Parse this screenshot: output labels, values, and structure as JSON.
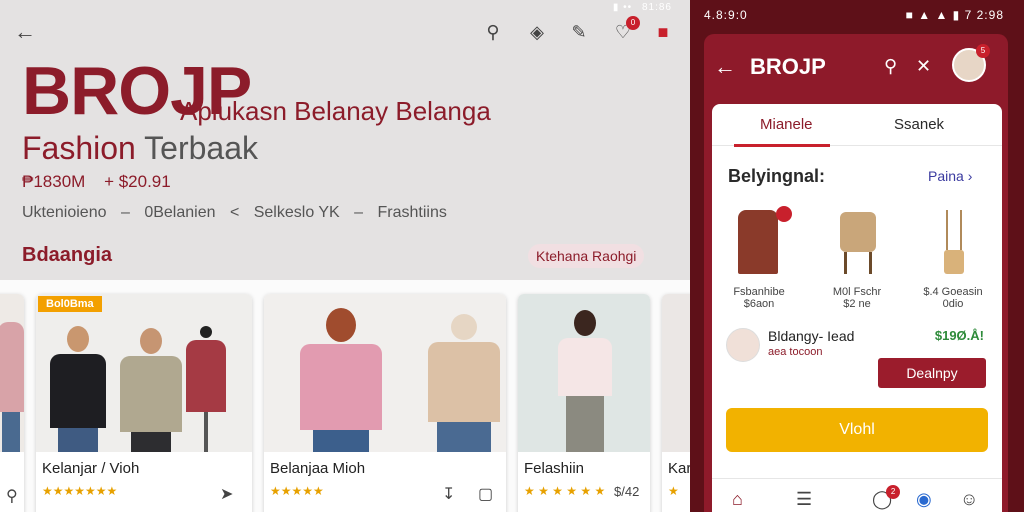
{
  "left": {
    "status_left": "▮ ••",
    "status_right": "81:86",
    "badge_count": "0",
    "brand": "BROJP",
    "tagline": "Aplukasn Belanay Belanga",
    "tag_a": "Fashion",
    "tag_b": "Terbaak",
    "price_1": "₱1830M",
    "price_2": "+ $20.91",
    "crumbs": [
      "Uktenioieno",
      "–",
      "0Belanien",
      "<",
      "Selkeslo YK",
      "–",
      "Frashtiins"
    ],
    "section_title": "Bdaangia",
    "section_pill": "Ktehana Raohgi",
    "cards": [
      {
        "title": "",
        "stars": ""
      },
      {
        "badge": "Bol0Bma",
        "title": "Kelanjar / Vioh",
        "stars": "★★★★★★★"
      },
      {
        "title": "Belanjaa Mioh",
        "stars": "★★★★★"
      },
      {
        "title": "Felashiin",
        "stars": "★ ★ ★ ★ ★ ★",
        "price": "$/42"
      },
      {
        "title": "Kar",
        "stars": "★"
      }
    ]
  },
  "phone": {
    "status_left": "4.8:9:0",
    "status_right": "7 2:98",
    "title": "BROJP",
    "avatar_badge": "5",
    "tab_1": "Mianele",
    "tab_2": "Ssanek",
    "heading": "Belyingnal:",
    "link": "Paina",
    "products": [
      {
        "l1": "Fsbanhibe",
        "l2": "$6aon"
      },
      {
        "l1": "M0l Fschr",
        "l2": "$2 ne"
      },
      {
        "l1": "$.4 Goeasin",
        "l2": "0dio"
      }
    ],
    "ship_name": "Bldangy- Iead",
    "ship_sub": "aea tocoon",
    "ship_price": "$19Ø.Å!",
    "btn_label": "Dealnpy",
    "cta_label": "Vlohl",
    "nav_badge": "2"
  },
  "colors": {
    "brand": "#8c1c2a",
    "accent_red": "#c8202c",
    "cta_yellow": "#f2b200",
    "phone_bg": "#8e1a2a"
  }
}
